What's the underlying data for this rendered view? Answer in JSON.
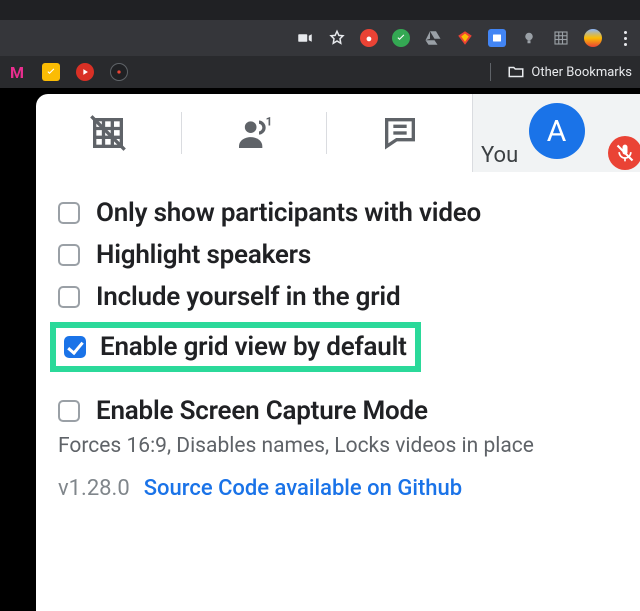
{
  "browser": {
    "bookmarks_label": "Other Bookmarks"
  },
  "tile": {
    "you_label": "You",
    "avatar_initial": "A"
  },
  "options": {
    "only_video": "Only show participants with video",
    "highlight_speakers": "Highlight speakers",
    "include_self": "Include yourself in the grid",
    "enable_default": "Enable grid view by default",
    "screen_capture": "Enable Screen Capture Mode",
    "screen_capture_desc": "Forces 16:9, Disables names, Locks videos in place"
  },
  "footer": {
    "version": "v1.28.0",
    "source_link": "Source Code available on Github"
  }
}
